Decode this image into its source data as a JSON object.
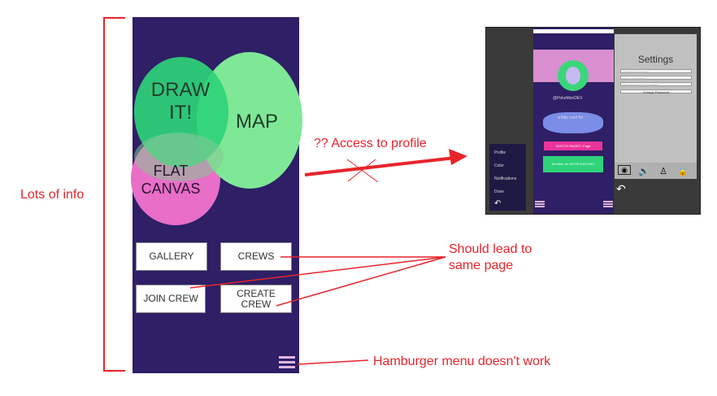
{
  "phone": {
    "circles": {
      "draw": "DRAW IT!",
      "map": "MAP",
      "flat": "FLAT CANVAS"
    },
    "buttons": {
      "gallery": "GALLERY",
      "crews": "CREWS",
      "join_crew": "JOIN CREW",
      "create_crew": "CREATE CREW"
    },
    "menu_icon": "hamburger-icon"
  },
  "annotations": {
    "lots_of_info": "Lots of info",
    "access_profile": "?? Access to profile",
    "same_page": "Should lead to same page",
    "hamburger": "Hamburger menu doesn't work"
  },
  "screenshot": {
    "menu_items": [
      "Profile",
      "Color",
      "Notifications",
      "Draw"
    ],
    "profile_name": "@PokeMonDEV",
    "profile_caption": "a little card for",
    "pink_button": "SWITCH PAGES / Page",
    "green_button": "Member of: NOTIFICATIONS",
    "settings": {
      "title": "Settings",
      "fields": [
        "Original password",
        "New password",
        "New Password (Confirm)"
      ],
      "change_button": "Change Password"
    }
  },
  "colors": {
    "phone_bg": "#2e1f66",
    "annotation_red": "#e8242b",
    "draw_circle": "#2fd37a",
    "map_circle": "#7ee896",
    "flat_circle": "#e86ec8"
  }
}
